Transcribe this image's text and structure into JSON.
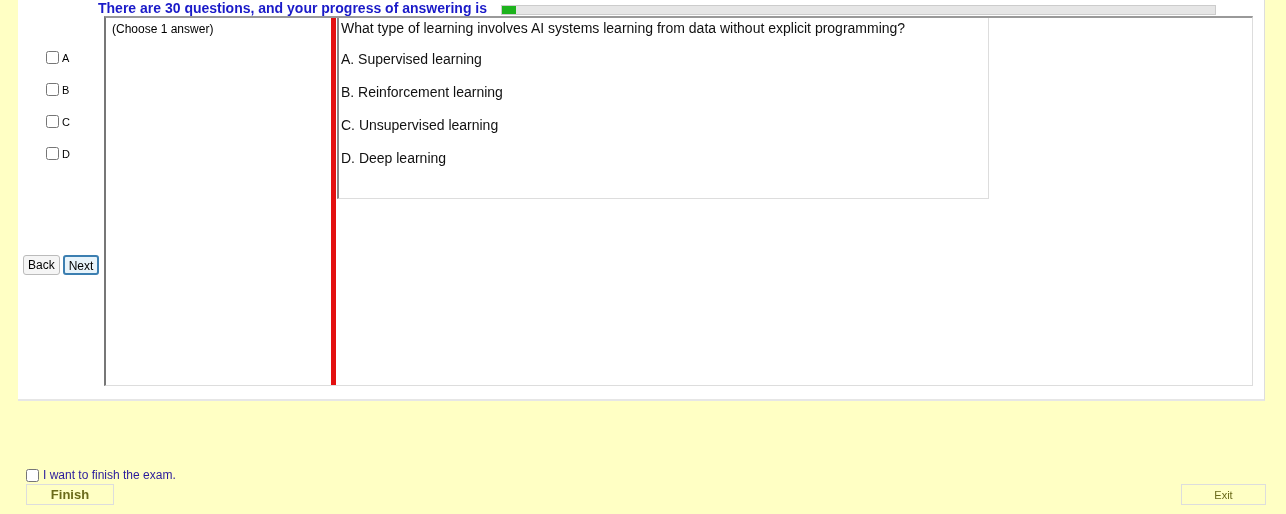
{
  "header": {
    "progress_text": "There are 30 questions, and your progress of answering is",
    "progress": {
      "level": 0.02
    }
  },
  "answer_choices": [
    {
      "label": "A",
      "checked": false
    },
    {
      "label": "B",
      "checked": false
    },
    {
      "label": "C",
      "checked": false
    },
    {
      "label": "D",
      "checked": false
    }
  ],
  "nav_buttons": [
    "Back",
    "Next"
  ],
  "instruction": "(Choose 1 answer)",
  "question": {
    "text": "What type of learning involves AI systems learning from data without explicit programming?",
    "options": [
      "A.  Supervised learning",
      "B.  Reinforcement learning",
      "C.  Unsupervised learning",
      "D.  Deep learning"
    ]
  },
  "finish": {
    "label": "I want to finish the exam.",
    "checked": false,
    "button": "Finish"
  },
  "exit_button": "Exit"
}
